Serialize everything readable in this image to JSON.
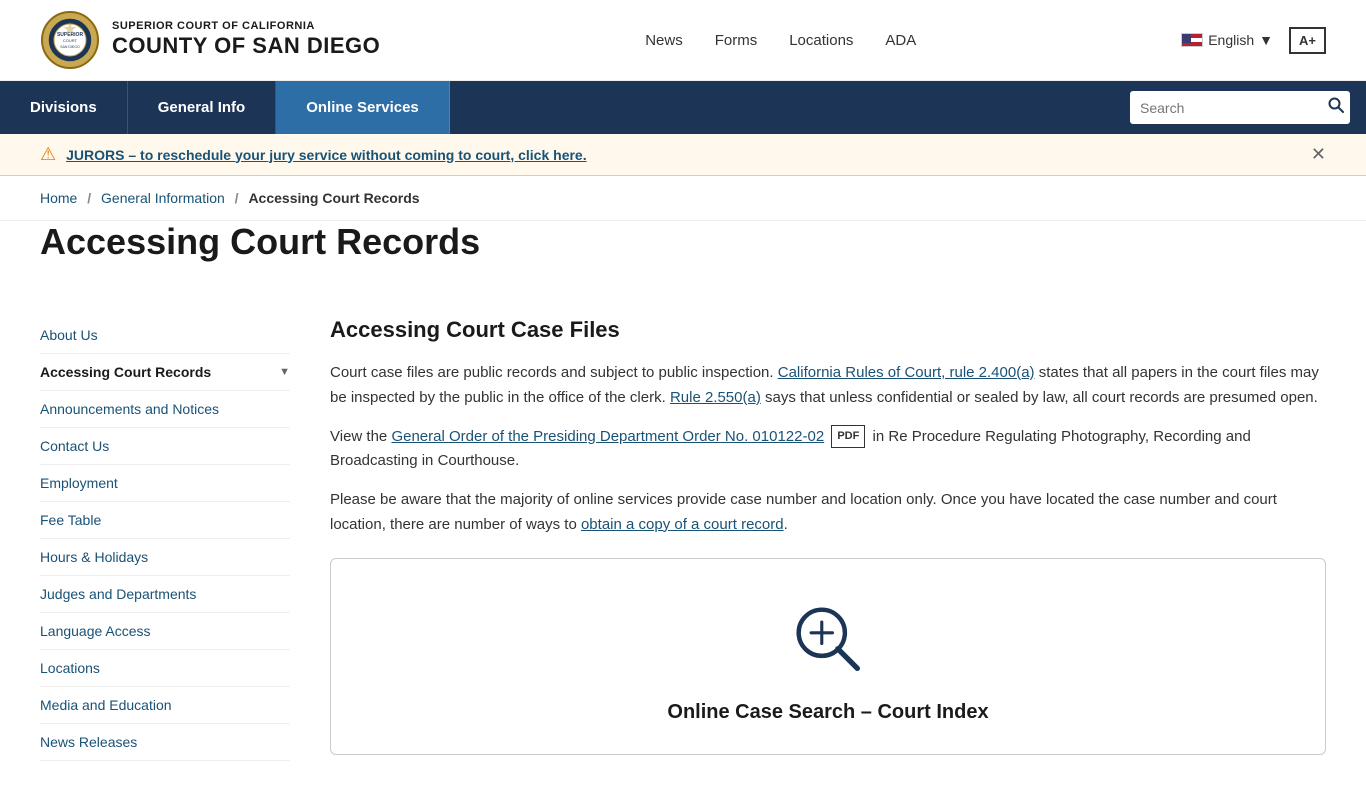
{
  "header": {
    "court_name_top": "SUPERIOR COURT OF CALIFORNIA",
    "court_name_bottom": "COUNTY OF SAN DIEGO",
    "nav_links": [
      {
        "label": "News",
        "href": "#"
      },
      {
        "label": "Forms",
        "href": "#"
      },
      {
        "label": "Locations",
        "href": "#"
      },
      {
        "label": "ADA",
        "href": "#"
      }
    ],
    "language": "English",
    "font_size_btn": "A+",
    "search_placeholder": "Search"
  },
  "navbar": {
    "items": [
      {
        "label": "Divisions",
        "active": false
      },
      {
        "label": "General Info",
        "active": false
      },
      {
        "label": "Online Services",
        "active": true
      }
    ]
  },
  "alert": {
    "text": "JURORS – to reschedule your jury service without coming to court, click here."
  },
  "breadcrumb": {
    "items": [
      {
        "label": "Home",
        "href": "#"
      },
      {
        "label": "General Information",
        "href": "#"
      },
      {
        "label": "Accessing Court Records",
        "current": true
      }
    ]
  },
  "page": {
    "title": "Accessing Court Records"
  },
  "sidebar": {
    "items": [
      {
        "label": "About Us",
        "active": false,
        "has_chevron": false
      },
      {
        "label": "Accessing Court Records",
        "active": true,
        "has_chevron": true
      },
      {
        "label": "Announcements and Notices",
        "active": false,
        "has_chevron": false
      },
      {
        "label": "Contact Us",
        "active": false,
        "has_chevron": false
      },
      {
        "label": "Employment",
        "active": false,
        "has_chevron": false
      },
      {
        "label": "Fee Table",
        "active": false,
        "has_chevron": false
      },
      {
        "label": "Hours & Holidays",
        "active": false,
        "has_chevron": false
      },
      {
        "label": "Judges and Departments",
        "active": false,
        "has_chevron": false
      },
      {
        "label": "Language Access",
        "active": false,
        "has_chevron": false
      },
      {
        "label": "Locations",
        "active": false,
        "has_chevron": false
      },
      {
        "label": "Media and Education",
        "active": false,
        "has_chevron": false
      },
      {
        "label": "News Releases",
        "active": false,
        "has_chevron": false
      }
    ]
  },
  "content": {
    "section_title": "Accessing Court Case Files",
    "para1_before_link1": "Court case files are public records and subject to public inspection.",
    "link1_text": "California Rules of Court, rule 2.400(a)",
    "para1_after_link1": "states that all papers in the court files may be inspected by the public in the office of the clerk.",
    "link2_text": "Rule 2.550(a)",
    "para1_after_link2": "says that unless confidential or sealed by law, all court records are presumed open.",
    "para2_before_link": "View the",
    "link3_text": "General Order of the Presiding Department Order No. 010122-02",
    "pdf_label": "PDF",
    "para2_after_link": "in Re Procedure Regulating Photography, Recording and Broadcasting in Courthouse.",
    "para3_before_link": "Please be aware that the majority of online services provide case number and location only.  Once you have located the case number and court location, there are number of ways to",
    "link4_text": "obtain a copy of a court record",
    "para3_after_link": ".",
    "search_card_title": "Online Case Search – Court Index"
  }
}
